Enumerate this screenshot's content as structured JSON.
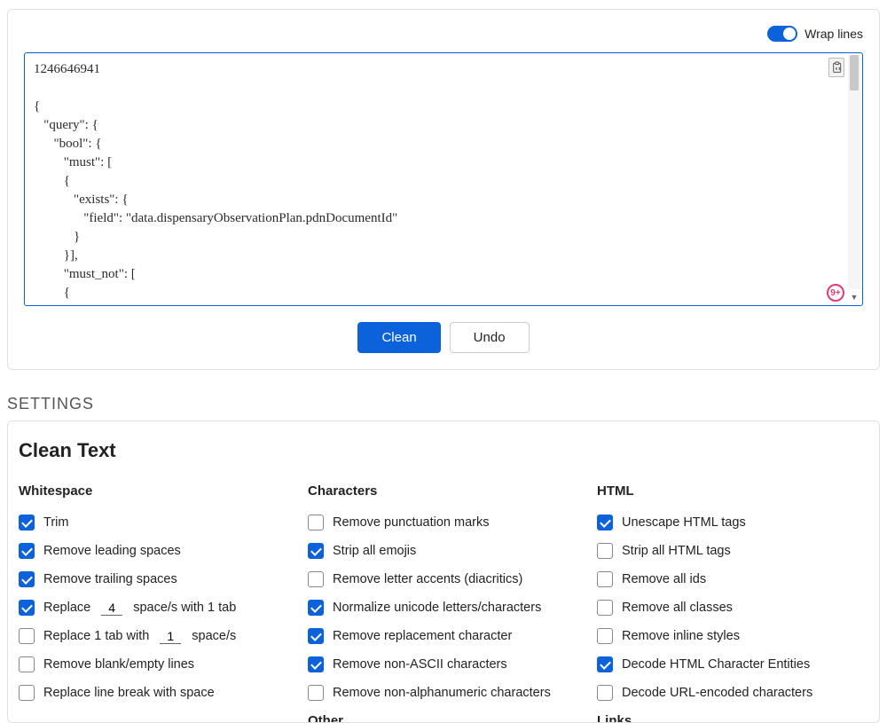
{
  "top": {
    "wrap_label": "Wrap lines",
    "textarea": "1246646941\n\n{\n   \"query\": {\n      \"bool\": {\n         \"must\": [\n         {\n            \"exists\": {\n               \"field\": \"data.dispensaryObservationPlan.pdnDocumentId\"\n            }\n         }],\n         \"must_not\": [\n         {\n            \"exists\": {",
    "badge": "9+",
    "clean_btn": "Clean",
    "undo_btn": "Undo"
  },
  "settings_label": "SETTINGS",
  "settings_title": "Clean Text",
  "whitespace": {
    "title": "Whitespace",
    "trim": "Trim",
    "remove_leading": "Remove leading spaces",
    "remove_trailing": "Remove trailing spaces",
    "replace_prefix": "Replace",
    "replace_spaces_val": "4",
    "replace_suffix": "space/s with 1 tab",
    "replace_tab_prefix": "Replace 1 tab with",
    "replace_tab_val": "1",
    "replace_tab_suffix": "space/s",
    "remove_blank": "Remove blank/empty lines",
    "replace_linebreak": "Replace line break with space"
  },
  "characters": {
    "title": "Characters",
    "remove_punct": "Remove punctuation marks",
    "strip_emoji": "Strip all emojis",
    "remove_accents": "Remove letter accents (diacritics)",
    "normalize": "Normalize unicode letters/characters",
    "remove_replacement": "Remove replacement character",
    "remove_nonascii": "Remove non-ASCII characters",
    "remove_nonalpha": "Remove non-alphanumeric characters",
    "other": "Other"
  },
  "html": {
    "title": "HTML",
    "unescape": "Unescape HTML tags",
    "strip_tags": "Strip all HTML tags",
    "remove_ids": "Remove all ids",
    "remove_classes": "Remove all classes",
    "remove_inline": "Remove inline styles",
    "decode_entities": "Decode HTML Character Entities",
    "decode_url": "Decode URL-encoded characters",
    "links": "Links"
  }
}
